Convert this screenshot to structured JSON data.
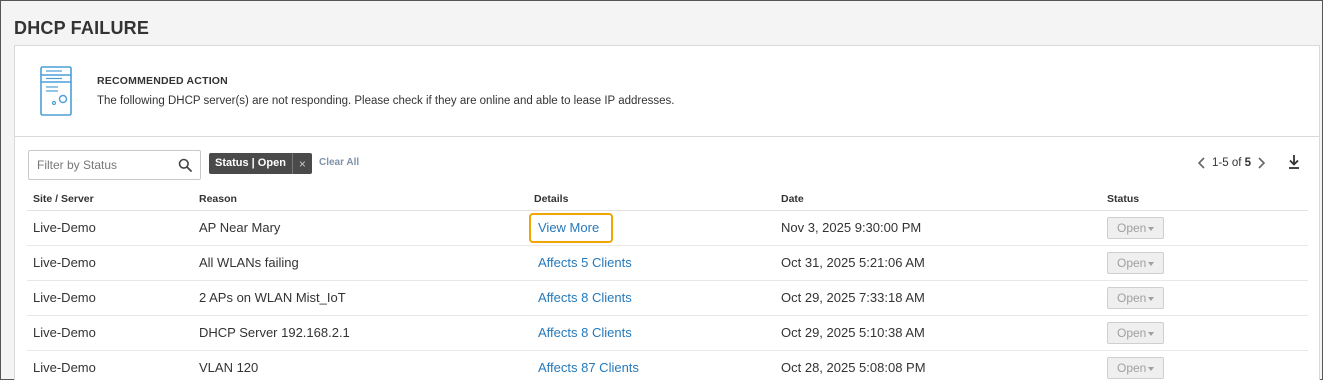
{
  "page": {
    "title": "DHCP FAILURE"
  },
  "recommendation": {
    "heading": "RECOMMENDED ACTION",
    "text": "The following DHCP server(s) are not responding. Please check if they are online and able to lease IP addresses."
  },
  "filter": {
    "placeholder": "Filter by Status",
    "chip_label": "Status | Open",
    "chip_remove": "×",
    "clear_all": "Clear All"
  },
  "pagination": {
    "range": "1-5",
    "of": "of",
    "total": "5"
  },
  "table": {
    "headers": {
      "site": "Site / Server",
      "reason": "Reason",
      "details": "Details",
      "date": "Date",
      "status": "Status"
    },
    "rows": [
      {
        "site": "Live-Demo",
        "reason": "AP Near Mary",
        "details": "View More",
        "date": "Nov 3, 2025 9:30:00 PM",
        "status": "Open"
      },
      {
        "site": "Live-Demo",
        "reason": "All WLANs failing",
        "details": "Affects 5 Clients",
        "date": "Oct 31, 2025 5:21:06 AM",
        "status": "Open"
      },
      {
        "site": "Live-Demo",
        "reason": "2 APs on WLAN Mist_IoT",
        "details": "Affects 8 Clients",
        "date": "Oct 29, 2025 7:33:18 AM",
        "status": "Open"
      },
      {
        "site": "Live-Demo",
        "reason": "DHCP Server 192.168.2.1",
        "details": "Affects 8 Clients",
        "date": "Oct 29, 2025 5:10:38 AM",
        "status": "Open"
      },
      {
        "site": "Live-Demo",
        "reason": "VLAN 120",
        "details": "Affects 87 Clients",
        "date": "Oct 28, 2025 5:08:08 PM",
        "status": "Open"
      }
    ]
  },
  "icons": {
    "server": "server-icon",
    "search": "search-icon",
    "prev": "chevron-left-icon",
    "next": "chevron-right-icon",
    "download": "download-icon"
  },
  "colors": {
    "link": "#2579bb",
    "highlight": "#f0a500",
    "chip_bg": "#4a4a4a",
    "icon_blue": "#4a9fd8"
  }
}
